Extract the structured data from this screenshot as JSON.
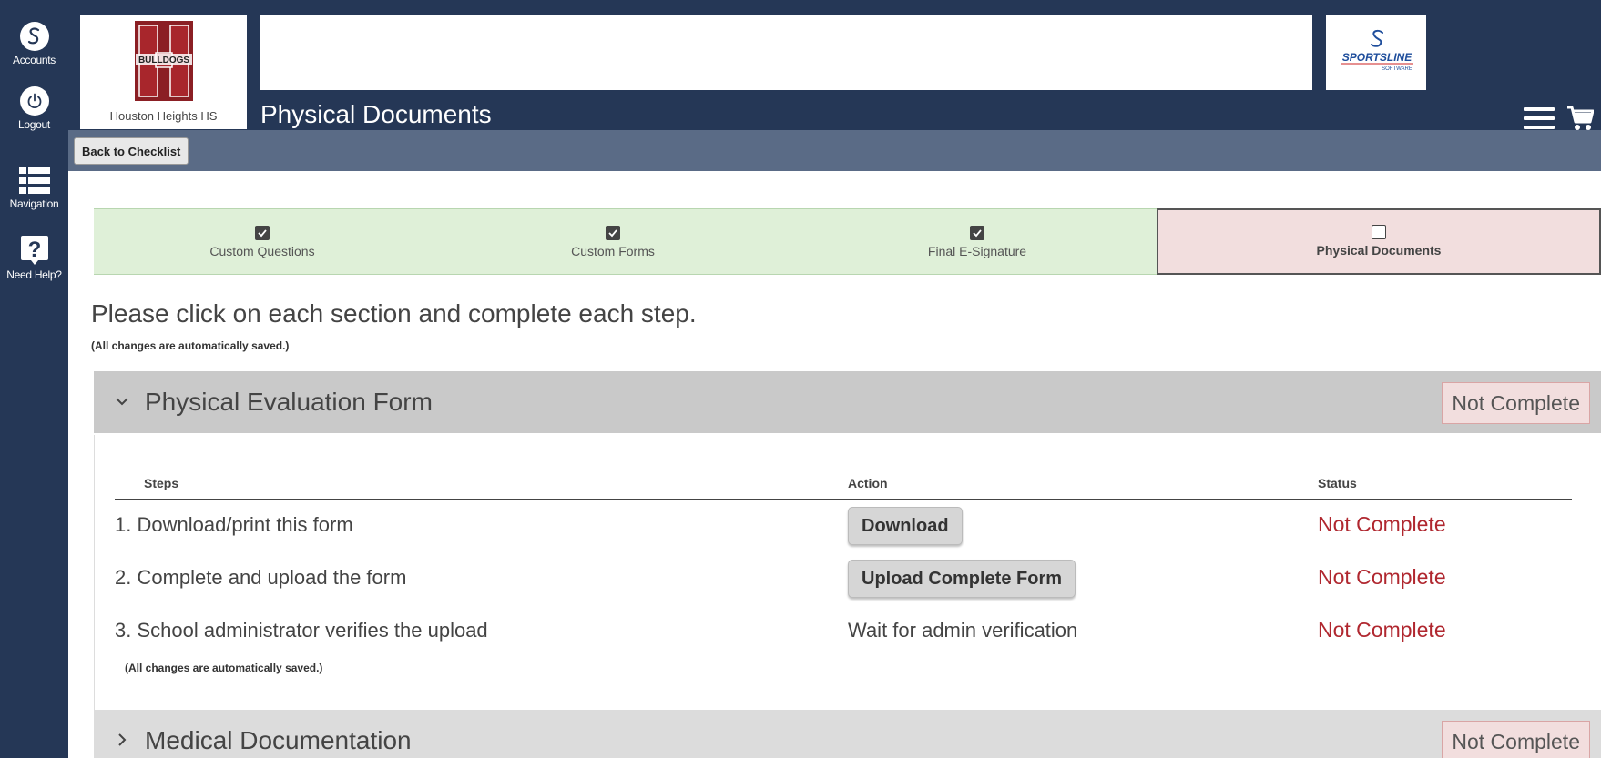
{
  "sidebar": {
    "items": [
      {
        "label": "Accounts",
        "icon": "sportsline-s-icon"
      },
      {
        "label": "Logout",
        "icon": "power-icon"
      },
      {
        "label": "Navigation",
        "icon": "list-icon"
      },
      {
        "label": "Need Help?",
        "icon": "question-icon"
      }
    ]
  },
  "header": {
    "school_name": "Houston Heights HS",
    "logo_letter": "H",
    "logo_text": "BULLDOGS",
    "page_title": "Physical Documents",
    "brand_name": "SPORTSLINE",
    "brand_sub": "SOFTWARE"
  },
  "subbar": {
    "back_label": "Back to Checklist"
  },
  "progress": {
    "steps": [
      {
        "label": "Custom Questions",
        "checked": true
      },
      {
        "label": "Custom Forms",
        "checked": true
      },
      {
        "label": "Final E-Signature",
        "checked": true
      },
      {
        "label": "Physical Documents",
        "checked": false
      }
    ]
  },
  "main": {
    "instruction": "Please click on each section and complete each step.",
    "saved_note": "(All changes are automatically saved.)"
  },
  "sections": [
    {
      "title": "Physical Evaluation Form",
      "status": "Not Complete",
      "expanded": true,
      "columns": [
        "Steps",
        "Action",
        "Status"
      ],
      "rows": [
        {
          "step": "1. Download/print this form",
          "action": "Download",
          "action_type": "button",
          "status": "Not Complete"
        },
        {
          "step": "2. Complete and upload the form",
          "action": "Upload Complete Form",
          "action_type": "button",
          "status": "Not Complete"
        },
        {
          "step": "3. School administrator verifies the upload",
          "action": "Wait for admin verification",
          "action_type": "text",
          "status": "Not Complete"
        }
      ],
      "saved_note": "(All changes are automatically saved.)"
    },
    {
      "title": "Medical Documentation",
      "status": "Not Complete",
      "expanded": false
    }
  ],
  "colors": {
    "sidebar_bg": "#253756",
    "subbar_bg": "#5a6b86",
    "done_bg": "#dff0d8",
    "current_bg": "#f2dede",
    "status_red": "#b0272f"
  }
}
